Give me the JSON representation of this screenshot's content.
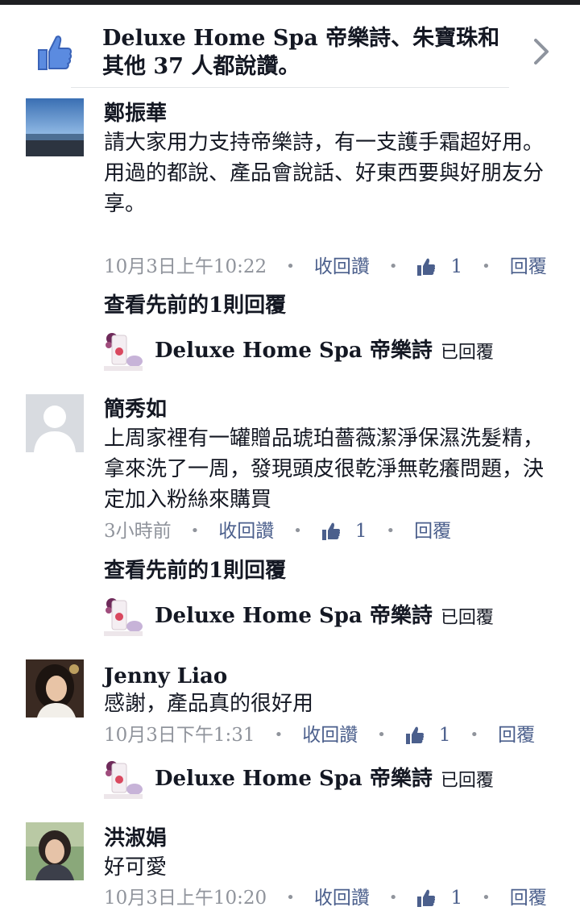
{
  "likes_summary": {
    "text": "Deluxe Home Spa 帝樂詩、朱寶珠和其他 37 人都說讚。"
  },
  "comments": [
    {
      "name": "鄭振華",
      "lines": [
        "請大家用力支持帝樂詩，有一支護手霜超好用。",
        "用過的都說、產品會說話、好東西要與好朋友分享。"
      ],
      "time": "10月3日上午10:22",
      "unlike_label": "收回讚",
      "like_count": "1",
      "reply_label": "回覆",
      "view_previous": "查看先前的1則回覆",
      "reply_from": "Deluxe Home Spa 帝樂詩",
      "reply_suffix": "已回覆"
    },
    {
      "name": "簡秀如",
      "lines": [
        "上周家裡有一罐贈品琥珀薔薇潔淨保濕洗髮精，拿來洗了一周，發現頭皮很乾淨無乾癢問題，決定加入粉絲來購買"
      ],
      "time": "3小時前",
      "unlike_label": "收回讚",
      "like_count": "1",
      "reply_label": "回覆",
      "view_previous": "查看先前的1則回覆",
      "reply_from": "Deluxe Home Spa 帝樂詩",
      "reply_suffix": "已回覆"
    },
    {
      "name": "Jenny Liao",
      "lines": [
        "感謝，產品真的很好用"
      ],
      "time": "10月3日下午1:31",
      "unlike_label": "收回讚",
      "like_count": "1",
      "reply_label": "回覆",
      "reply_from": "Deluxe Home Spa 帝樂詩",
      "reply_suffix": "已回覆"
    },
    {
      "name": "洪淑娟",
      "lines": [
        "好可愛"
      ],
      "time": "10月3日上午10:20",
      "unlike_label": "收回讚",
      "like_count": "1",
      "reply_label": "回覆"
    }
  ],
  "icons": {
    "likes": "thumbs-up-icon",
    "chevron": "chevron-right-icon",
    "like_inline": "small-thumbs-up-icon"
  },
  "colors": {
    "link": "#4b5f8c",
    "meta": "#90949c",
    "like_blue": "#4a76d3"
  }
}
